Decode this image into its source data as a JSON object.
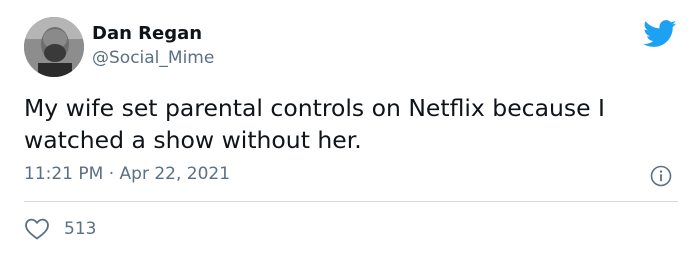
{
  "user": {
    "display_name": "Dan Regan",
    "handle": "@Social_Mime"
  },
  "tweet": {
    "text": "My wife set parental controls on Netflix because I watched a show without her.",
    "timestamp": "11:21 PM · Apr 22, 2021",
    "like_count": "513"
  },
  "icons": {
    "brand": "twitter-bird-icon",
    "info": "info-icon",
    "like": "heart-icon"
  },
  "colors": {
    "brand_blue": "#1da1f2",
    "secondary_text": "#5b7083",
    "primary_text": "#0f1419",
    "divider": "#cfd9de"
  }
}
